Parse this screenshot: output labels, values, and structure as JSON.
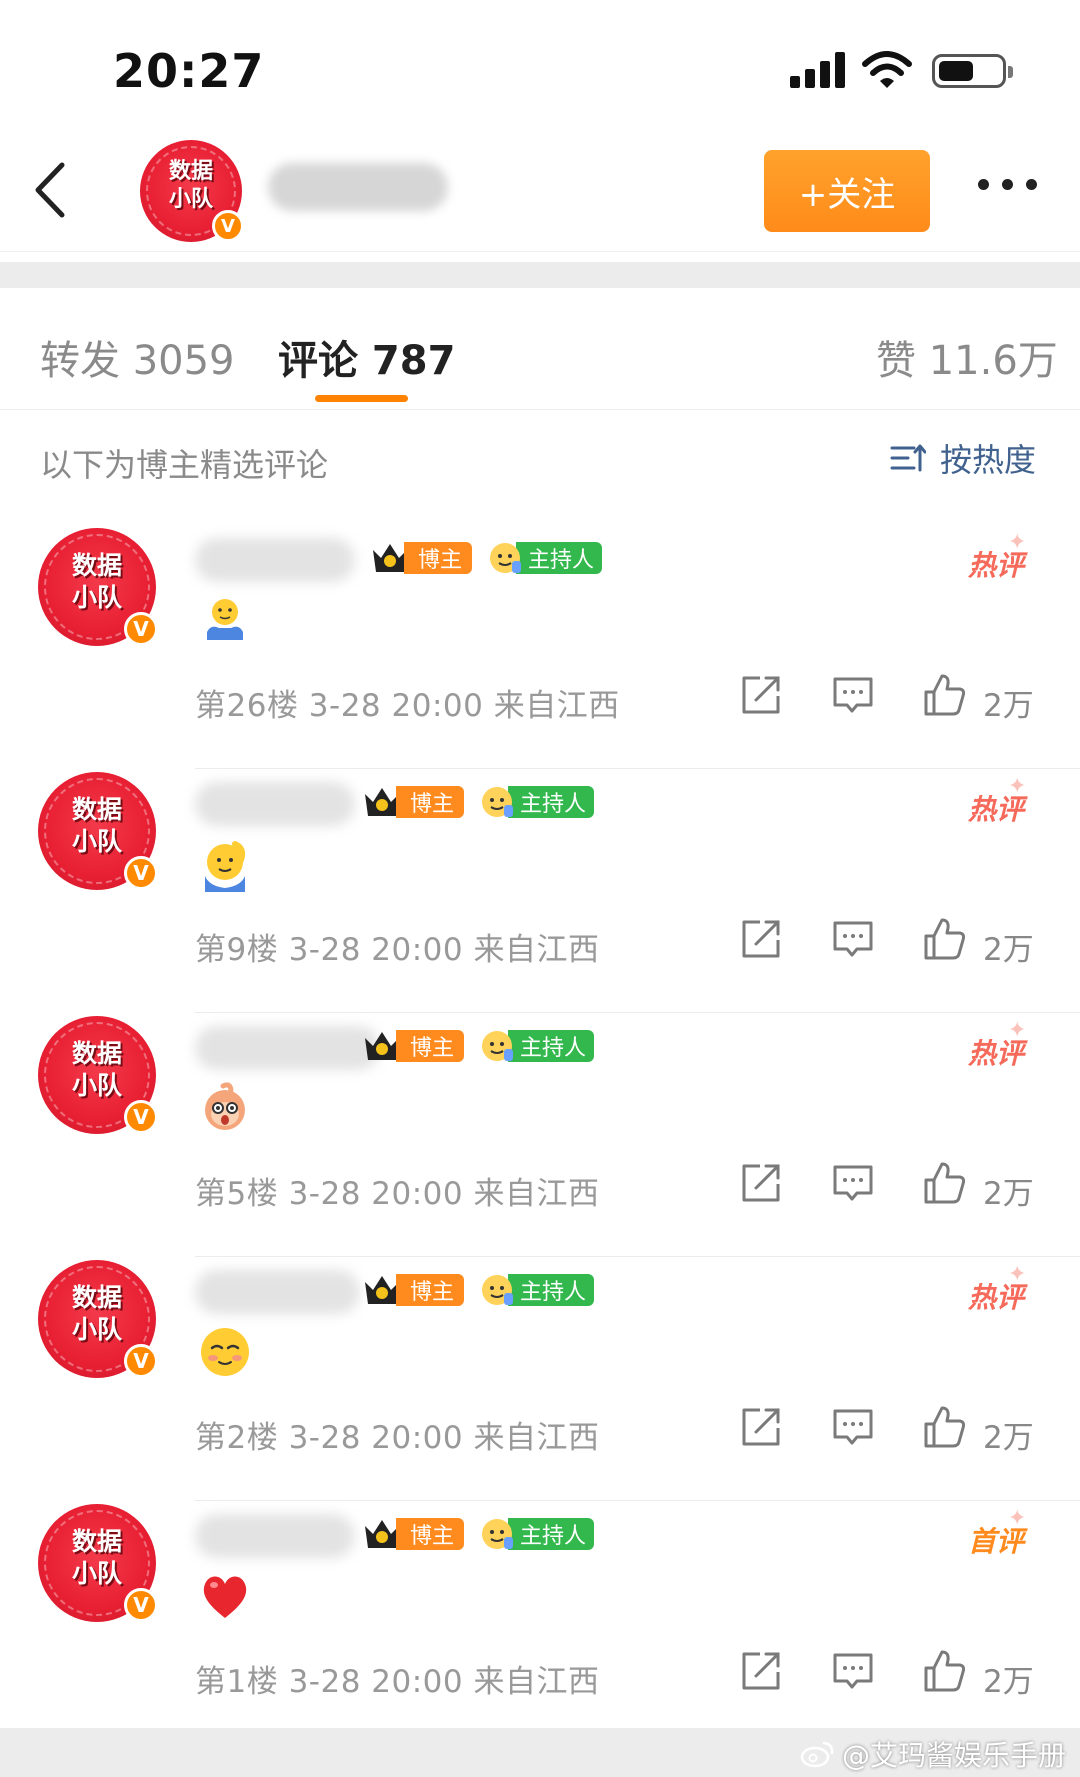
{
  "status_bar": {
    "time": "20:27"
  },
  "header": {
    "follow_label": "+关注",
    "avatar_text_line1": "数据",
    "avatar_text_line2": "小队",
    "verified_mark": "V"
  },
  "tabs": [
    {
      "label": "转发 3059",
      "active": false
    },
    {
      "label": "评论 787",
      "active": true
    },
    {
      "label": "赞 11.6万",
      "active": false
    }
  ],
  "accent_color": "#ff8200",
  "filter": {
    "text": "以下为博主精选评论",
    "sort_label": "按热度"
  },
  "badges": {
    "blogger": "博主",
    "host": "主持人"
  },
  "comments": [
    {
      "tag": "热评",
      "emoji": "shrug-emoji",
      "meta": "第26楼 3-28 20:00 来自江西",
      "likes": "2万"
    },
    {
      "tag": "热评",
      "emoji": "salute-emoji",
      "meta": "第9楼 3-28 20:00 来自江西",
      "likes": "2万"
    },
    {
      "tag": "热评",
      "emoji": "shocked-monkey-emoji",
      "meta": "第5楼 3-28 20:00 来自江西",
      "likes": "2万"
    },
    {
      "tag": "热评",
      "emoji": "blush-emoji",
      "meta": "第2楼 3-28 20:00 来自江西",
      "likes": "2万"
    },
    {
      "tag": "首评",
      "emoji": "heart-emoji",
      "meta": "第1楼 3-28 20:00 来自江西",
      "likes": "2万"
    }
  ],
  "watermark": "@艾玛酱娱乐手册"
}
